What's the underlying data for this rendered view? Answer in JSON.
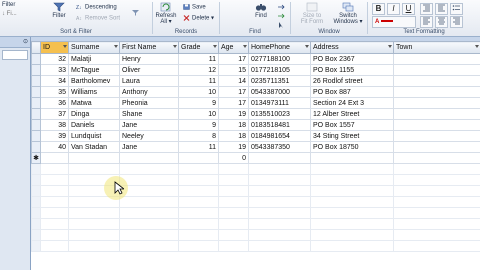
{
  "ribbon": {
    "sort_filter": {
      "filter_label": "Filter",
      "descending_label": "Descending",
      "remove_sort_label": "Remove Sort",
      "top_partial": "Filter",
      "group_label": "Sort & Filter"
    },
    "records": {
      "refresh_label": "Refresh",
      "refresh_sub": "All",
      "save_label": "Save",
      "delete_label": "Delete",
      "group_label": "Records"
    },
    "find": {
      "find_label": "Find",
      "group_label": "Find"
    },
    "window": {
      "size_to_fit_label": "Size to",
      "size_to_fit_sub": "Fit Form",
      "switch_windows_label": "Switch",
      "switch_windows_sub": "Windows",
      "group_label": "Window"
    },
    "text_formatting": {
      "bold": "B",
      "italic": "I",
      "underline": "U",
      "group_label": "Text Formatting"
    }
  },
  "navpane": {
    "header": ""
  },
  "table": {
    "columns": [
      "ID",
      "Surname",
      "First Name",
      "Grade",
      "Age",
      "HomePhone",
      "Address",
      "Town"
    ],
    "rows": [
      {
        "id": "32",
        "surname": "Malatji",
        "first": "Henry",
        "grade": "11",
        "age": "17",
        "phone": "0277188100",
        "address": "PO Box 2367",
        "town": ""
      },
      {
        "id": "33",
        "surname": "McTague",
        "first": "Oliver",
        "grade": "12",
        "age": "15",
        "phone": "0177218105",
        "address": "PO Box 1155",
        "town": ""
      },
      {
        "id": "34",
        "surname": "Bartholomev",
        "first": "Laura",
        "grade": "11",
        "age": "14",
        "phone": "0235711351",
        "address": "26 Rodlof street",
        "town": ""
      },
      {
        "id": "35",
        "surname": "Williams",
        "first": "Anthony",
        "grade": "10",
        "age": "17",
        "phone": "0543387000",
        "address": "PO Box 887",
        "town": ""
      },
      {
        "id": "36",
        "surname": "Matwa",
        "first": "Pheonia",
        "grade": "9",
        "age": "17",
        "phone": "0134973111",
        "address": "Section 24 Ext 3",
        "town": ""
      },
      {
        "id": "37",
        "surname": "Dinga",
        "first": "Shane",
        "grade": "10",
        "age": "19",
        "phone": "0135510023",
        "address": "12 Alber Street",
        "town": ""
      },
      {
        "id": "38",
        "surname": "Daniels",
        "first": "Jane",
        "grade": "9",
        "age": "18",
        "phone": "0183518481",
        "address": "PO Box 1557",
        "town": ""
      },
      {
        "id": "39",
        "surname": "Lundquist",
        "first": "Neeley",
        "grade": "8",
        "age": "18",
        "phone": "0184981654",
        "address": "34 Sting Street",
        "town": ""
      },
      {
        "id": "40",
        "surname": "Van Stadan",
        "first": "Jane",
        "grade": "11",
        "age": "19",
        "phone": "0543387350",
        "address": "PO Box 18750",
        "town": ""
      }
    ],
    "new_row": {
      "marker": "✱",
      "id": "",
      "age": "0"
    }
  },
  "colors": {
    "selected_header": "#f5c04f",
    "ribbon_border": "#9ab0cc"
  }
}
